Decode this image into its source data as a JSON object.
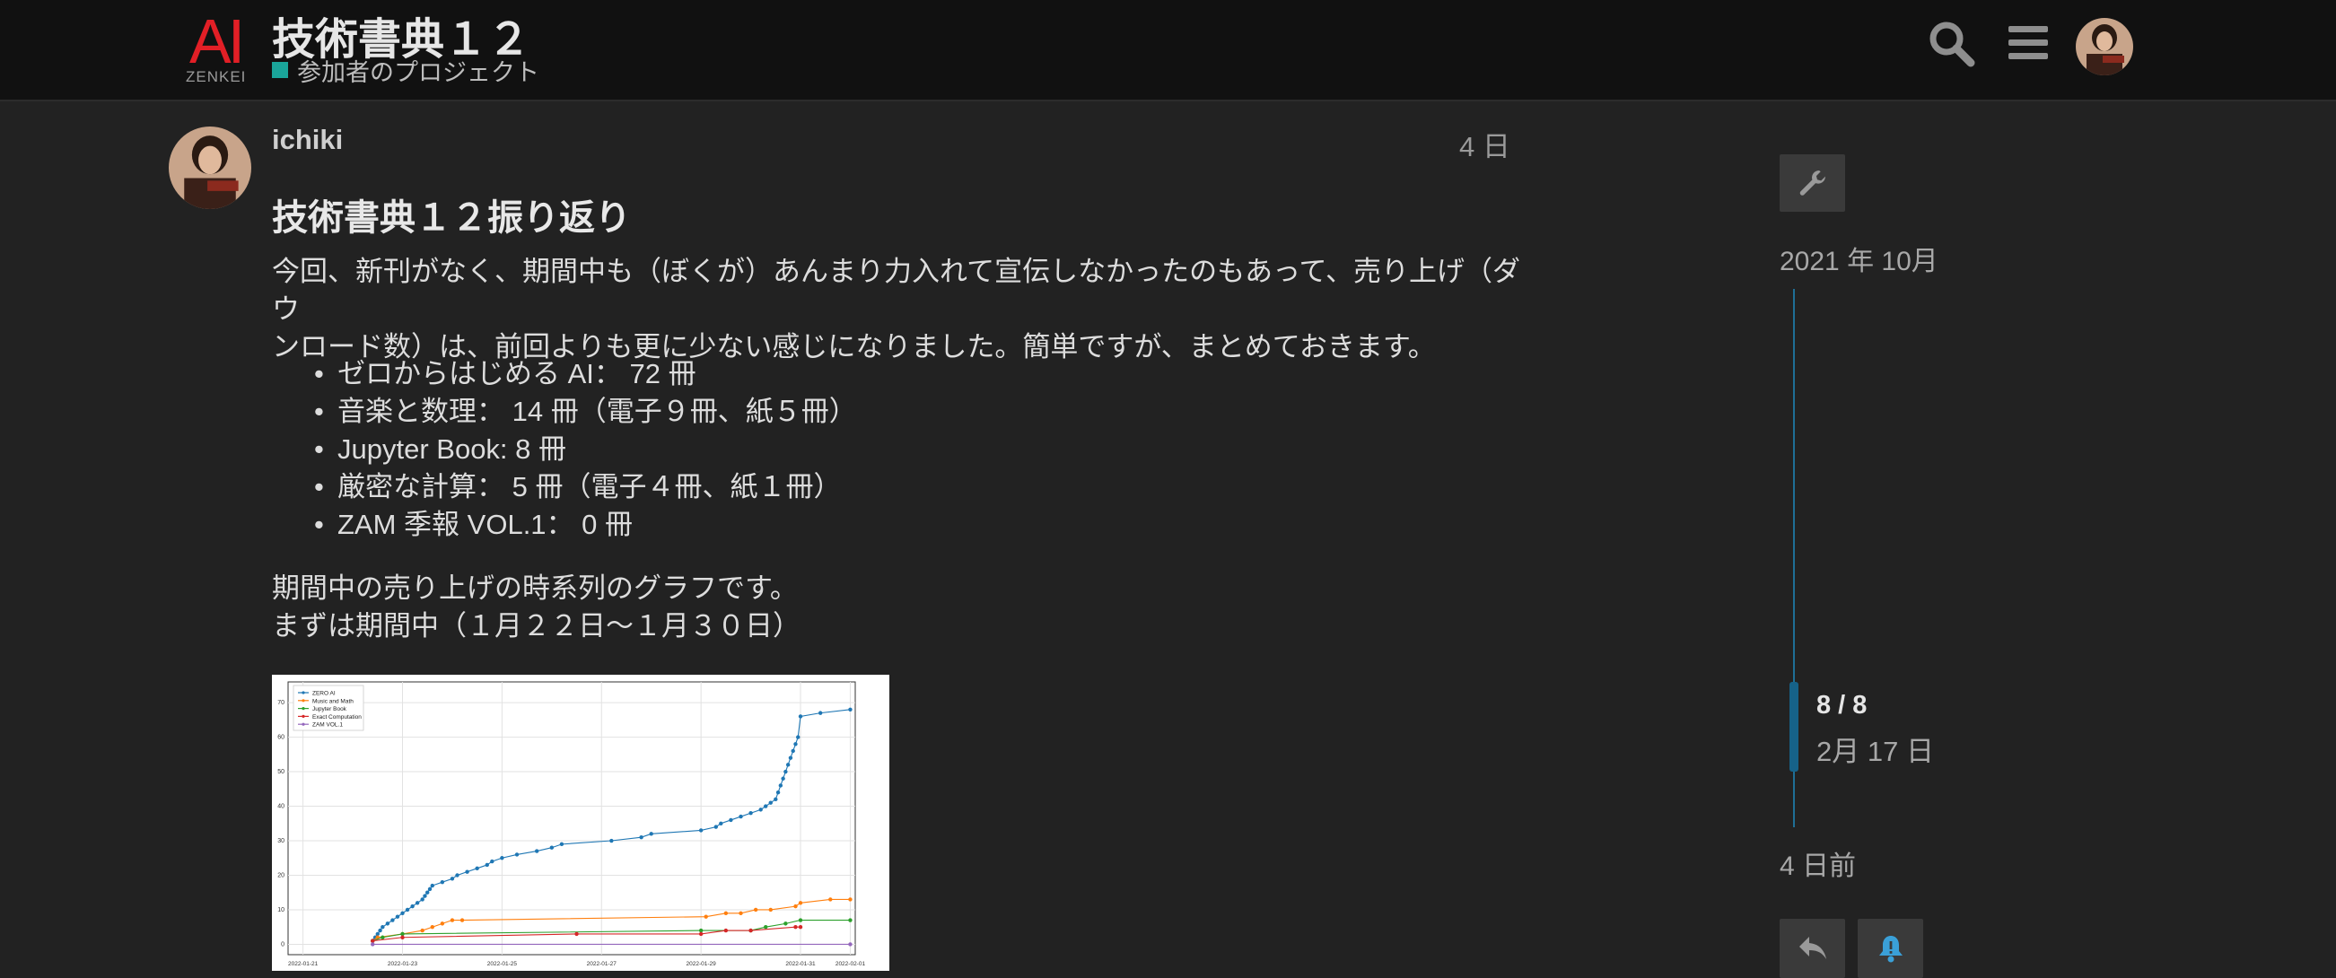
{
  "header": {
    "logo_text": "AI",
    "logo_sub": "ZENKEI",
    "title": "技術書典１２",
    "category": "参加者のプロジェクト",
    "category_color": "#1aa59a",
    "icons": [
      "search-icon",
      "hamburger-menu-icon",
      "user-avatar"
    ]
  },
  "post": {
    "username": "ichiki",
    "date": "4 日",
    "heading": "技術書典１２振り返り",
    "intro_line1": "今回、新刊がなく、期間中も（ぼくが）あんまり力入れて宣伝しなかったのもあって、売り上げ（ダウ",
    "intro_line2": "ンロード数）は、前回よりも更に少ない感じになりました。簡単ですが、まとめておきます。",
    "list": [
      "ゼロからはじめる AI： 72 冊",
      "音楽と数理： 14 冊（電子９冊、紙５冊）",
      "Jupyter Book: 8 冊",
      "厳密な計算： 5 冊（電子４冊、紙１冊）",
      "ZAM 季報 VOL.1： 0 冊"
    ],
    "para2_line1": "期間中の売り上げの時系列のグラフです。",
    "para2_line2": "まずは期間中（１月２２日〜１月３０日）"
  },
  "timeline": {
    "start_label": "2021 年 10月",
    "position": "8 / 8",
    "position_date": "2月 17 日",
    "end_label": "4 日前"
  },
  "actions": [
    "wrench-icon",
    "reply-icon",
    "bell-icon"
  ],
  "chart_data": {
    "type": "line",
    "x_tick_labels": [
      "2022-01-21",
      "2022-01-23",
      "2022-01-25",
      "2022-01-27",
      "2022-01-29",
      "2022-01-31",
      "2022-02-01"
    ],
    "y_ticks": [
      0,
      10,
      20,
      30,
      40,
      50,
      60,
      70
    ],
    "xlim": [
      20.7,
      32.1
    ],
    "ylim": [
      -3,
      76
    ],
    "grid": true,
    "legend": "top-left",
    "series": [
      {
        "name": "ZERO AI",
        "color": "#1f77b4",
        "x": [
          22.4,
          22.45,
          22.5,
          22.55,
          22.6,
          22.7,
          22.8,
          22.9,
          23.0,
          23.1,
          23.2,
          23.3,
          23.4,
          23.45,
          23.5,
          23.55,
          23.6,
          23.8,
          24.0,
          24.1,
          24.3,
          24.5,
          24.7,
          24.8,
          25.0,
          25.3,
          25.7,
          26.0,
          26.2,
          27.2,
          27.8,
          28.0,
          29.0,
          29.3,
          29.4,
          29.6,
          29.8,
          30.0,
          30.2,
          30.3,
          30.4,
          30.5,
          30.55,
          30.6,
          30.65,
          30.7,
          30.75,
          30.8,
          30.85,
          30.9,
          30.95,
          31.0,
          31.4,
          32.0
        ],
        "y": [
          1,
          2,
          3,
          4,
          5,
          6,
          7,
          8,
          9,
          10,
          11,
          12,
          13,
          14,
          15,
          16,
          17,
          18,
          19,
          20,
          21,
          22,
          23,
          24,
          25,
          26,
          27,
          28,
          29,
          30,
          31,
          32,
          33,
          34,
          35,
          36,
          37,
          38,
          39,
          40,
          41,
          42,
          44,
          46,
          48,
          50,
          52,
          54,
          56,
          58,
          60,
          66,
          67,
          68
        ]
      },
      {
        "name": "Music and Math",
        "color": "#ff7f0e",
        "x": [
          22.4,
          22.5,
          23.0,
          23.4,
          23.6,
          23.8,
          24.0,
          24.2,
          29.1,
          29.5,
          29.8,
          30.1,
          30.4,
          30.9,
          31.0,
          31.6,
          32.0
        ],
        "y": [
          1,
          2,
          3,
          4,
          5,
          6,
          7,
          7,
          8,
          9,
          9,
          10,
          10,
          11,
          12,
          13,
          13
        ]
      },
      {
        "name": "Jupyter Book",
        "color": "#2ca02c",
        "x": [
          22.4,
          22.6,
          23.0,
          29.0,
          30.0,
          30.3,
          30.7,
          31.0,
          32.0
        ],
        "y": [
          1,
          2,
          3,
          4,
          4,
          5,
          6,
          7,
          7
        ]
      },
      {
        "name": "Exact Computation",
        "color": "#d62728",
        "x": [
          22.4,
          23.0,
          26.5,
          29.0,
          29.5,
          30.0,
          30.9,
          31.0
        ],
        "y": [
          1,
          2,
          3,
          3,
          4,
          4,
          5,
          5
        ]
      },
      {
        "name": "ZAM VOL.1",
        "color": "#9467bd",
        "x": [
          22.4,
          32.0
        ],
        "y": [
          0,
          0
        ]
      }
    ]
  }
}
